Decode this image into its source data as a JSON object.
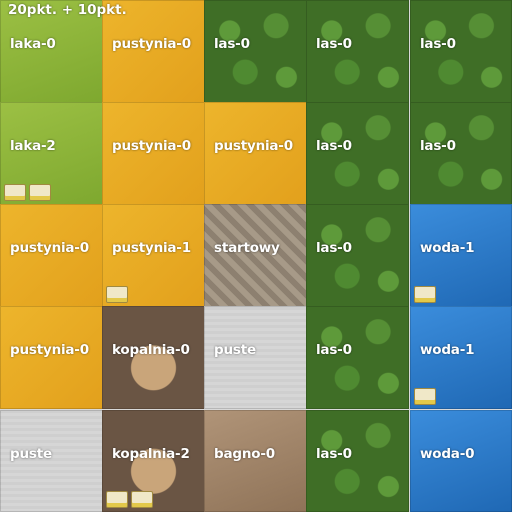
{
  "score": "20pkt. + 10pkt.",
  "board": {
    "tiles": [
      [
        "laka-0",
        "pustynia-0",
        "las-0",
        "las-0",
        "las-0"
      ],
      [
        "laka-2",
        "pustynia-0",
        "pustynia-0",
        "las-0",
        "las-0"
      ],
      [
        "pustynia-0",
        "pustynia-1",
        "startowy",
        "las-0",
        "woda-1"
      ],
      [
        "pustynia-0",
        "kopalnia-0",
        "puste",
        "las-0",
        "woda-1"
      ],
      [
        "puste",
        "kopalnia-2",
        "bagno-0",
        "las-0",
        "woda-0"
      ]
    ]
  },
  "terrain_colors": {
    "laka": "#8fb33a",
    "pustynia": "#e6ab22",
    "las": "#3f6e26",
    "startowy": "#9a8c7c",
    "puste": "#d2d2d2",
    "kopalnia": "#6a5544",
    "woda": "#2f7bc8",
    "bagno": "#a88c70"
  }
}
